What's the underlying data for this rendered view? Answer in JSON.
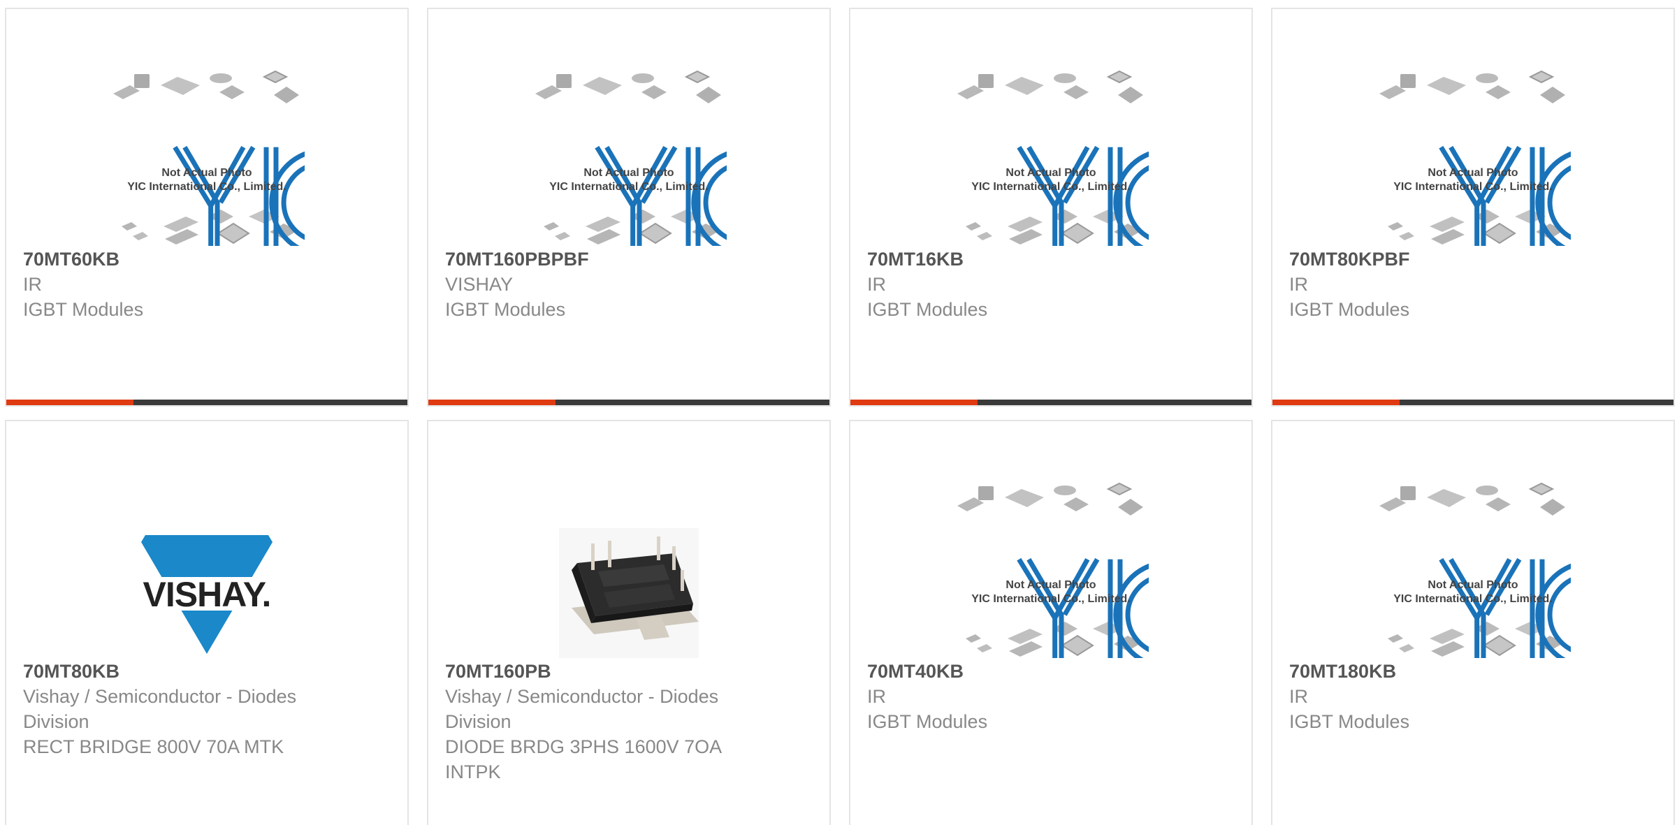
{
  "placeholder_image": {
    "brand": "YIC",
    "caption_line1": "Not Actual Photo",
    "caption_line2": "YIC International Co., Limited."
  },
  "vishay_logo_text": "VISHAY.",
  "colors": {
    "accent_bar": "#e03a12",
    "dark_bar": "#3a3a3a",
    "card_border": "#e4e4e4",
    "part_text": "#555555",
    "meta_text": "#888888",
    "vishay_blue": "#1a88c9",
    "yic_blue": "#1a73b9"
  },
  "products": [
    {
      "part": "70MT60KB",
      "manufacturer": "IR",
      "description": "IGBT Modules",
      "image": "yic-placeholder"
    },
    {
      "part": "70MT160PBPBF",
      "manufacturer": "VISHAY",
      "description": "IGBT Modules",
      "image": "yic-placeholder"
    },
    {
      "part": "70MT16KB",
      "manufacturer": "IR",
      "description": "IGBT Modules",
      "image": "yic-placeholder"
    },
    {
      "part": "70MT80KPBF",
      "manufacturer": "IR",
      "description": "IGBT Modules",
      "image": "yic-placeholder"
    },
    {
      "part": "70MT80KB",
      "manufacturer_line1": "Vishay / Semiconductor - Diodes",
      "manufacturer_line2": "Division",
      "description": "RECT BRIDGE 800V 70A MTK",
      "image": "vishay-logo"
    },
    {
      "part": "70MT160PB",
      "manufacturer_line1": "Vishay / Semiconductor - Diodes",
      "manufacturer_line2": "Division",
      "description_line1": "DIODE BRDG 3PHS 1600V 7OA",
      "description_line2": "INTPK",
      "image": "module-photo"
    },
    {
      "part": "70MT40KB",
      "manufacturer": "IR",
      "description": "IGBT Modules",
      "image": "yic-placeholder"
    },
    {
      "part": "70MT180KB",
      "manufacturer": "IR",
      "description": "IGBT Modules",
      "image": "yic-placeholder"
    }
  ]
}
